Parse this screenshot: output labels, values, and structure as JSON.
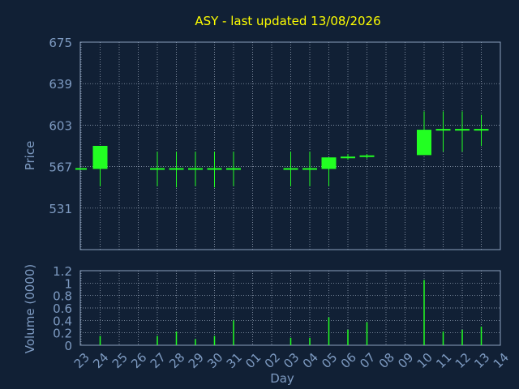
{
  "chart_data": {
    "type": "candlestick",
    "title": "ASY - last updated 13/08/2026",
    "xlabel": "Day",
    "price_panel": {
      "ylabel": "Price",
      "ylim": [
        495,
        675
      ],
      "yticks": [
        531,
        567,
        603,
        639,
        675
      ]
    },
    "volume_panel": {
      "ylabel": "Volume (0000)",
      "ylim": [
        0,
        1.2
      ],
      "yticks": [
        0,
        0.2,
        0.4,
        0.6,
        0.8,
        1,
        1.2
      ],
      "ytick_labels": [
        "0",
        "0.2",
        "0.4",
        "0.6",
        "0.8",
        "1",
        "1.2"
      ]
    },
    "days": [
      "23",
      "24",
      "25",
      "26",
      "27",
      "28",
      "29",
      "30",
      "31",
      "01",
      "02",
      "03",
      "04",
      "05",
      "06",
      "07",
      "08",
      "09",
      "10",
      "11",
      "12",
      "13",
      "14"
    ],
    "candles": [
      {
        "day": "23",
        "open": 565,
        "high": 565,
        "low": 565,
        "close": 565,
        "volume": 0
      },
      {
        "day": "24",
        "open": 565,
        "high": 585,
        "low": 550,
        "close": 585,
        "volume": 0.15
      },
      {
        "day": "27",
        "open": 565,
        "high": 580,
        "low": 550,
        "close": 565,
        "volume": 0.15
      },
      {
        "day": "28",
        "open": 565,
        "high": 580,
        "low": 549,
        "close": 565,
        "volume": 0.22
      },
      {
        "day": "29",
        "open": 565,
        "high": 580,
        "low": 550,
        "close": 565,
        "volume": 0.1
      },
      {
        "day": "30",
        "open": 565,
        "high": 580,
        "low": 549,
        "close": 565,
        "volume": 0.15
      },
      {
        "day": "31",
        "open": 565,
        "high": 580,
        "low": 550,
        "close": 565,
        "volume": 0.4
      },
      {
        "day": "03",
        "open": 565,
        "high": 580,
        "low": 550,
        "close": 565,
        "volume": 0.12
      },
      {
        "day": "04",
        "open": 565,
        "high": 580,
        "low": 550,
        "close": 565,
        "volume": 0.12
      },
      {
        "day": "05",
        "open": 565,
        "high": 575,
        "low": 550,
        "close": 575,
        "volume": 0.45
      },
      {
        "day": "06",
        "open": 575,
        "high": 578,
        "low": 573,
        "close": 575,
        "volume": 0.25
      },
      {
        "day": "07",
        "open": 576,
        "high": 578,
        "low": 574,
        "close": 576,
        "volume": 0.37
      },
      {
        "day": "10",
        "open": 577,
        "high": 615,
        "low": 577,
        "close": 599,
        "volume": 1.05
      },
      {
        "day": "11",
        "open": 599,
        "high": 615,
        "low": 580,
        "close": 599,
        "volume": 0.22
      },
      {
        "day": "12",
        "open": 599,
        "high": 615,
        "low": 580,
        "close": 599,
        "volume": 0.25
      },
      {
        "day": "13",
        "open": 599,
        "high": 612,
        "low": 585,
        "close": 599,
        "volume": 0.3
      }
    ],
    "grid": true,
    "colors": {
      "background": "#112035",
      "plot_border": "#8aa0bd",
      "grid": "#a8b6c9",
      "candle": "#22ff22",
      "title": "#ffff00",
      "axis_text": "#7e9bc2"
    }
  }
}
